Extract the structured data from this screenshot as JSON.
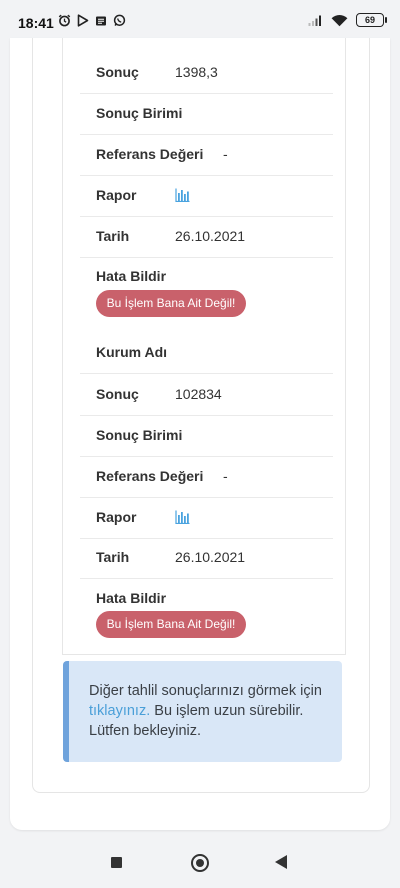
{
  "status_bar": {
    "time": "18:41",
    "battery": "69"
  },
  "records": [
    {
      "rows": [
        {
          "label": "Sonuç",
          "value": "1398,3"
        },
        {
          "label": "Sonuç Birimi",
          "value": ""
        },
        {
          "label": "Referans Değeri",
          "value": "-"
        },
        {
          "label": "Rapor",
          "icon": "bar-chart-icon"
        },
        {
          "label": "Tarih",
          "value": "26.10.2021"
        }
      ],
      "error_label": "Hata Bildir",
      "error_button": "Bu İşlem Bana Ait Değil!"
    },
    {
      "institution_label": "Kurum Adı",
      "rows": [
        {
          "label": "Sonuç",
          "value": "102834"
        },
        {
          "label": "Sonuç Birimi",
          "value": ""
        },
        {
          "label": "Referans Değeri",
          "value": "-"
        },
        {
          "label": "Rapor",
          "icon": "bar-chart-icon"
        },
        {
          "label": "Tarih",
          "value": "26.10.2021"
        }
      ],
      "error_label": "Hata Bildir",
      "error_button": "Bu İşlem Bana Ait Değil!"
    }
  ],
  "info": {
    "text_before": "Diğer tahlil sonuçlarınızı görmek için ",
    "link": "tıklayınız.",
    "text_after": " Bu işlem uzun sürebilir. Lütfen bekleyiniz."
  },
  "colors": {
    "error_button": "#c9616b",
    "info_bg": "#d9e7f7",
    "info_border": "#6fa3dc",
    "link": "#4a9fd8",
    "chart_icon": "#4aa3df"
  }
}
